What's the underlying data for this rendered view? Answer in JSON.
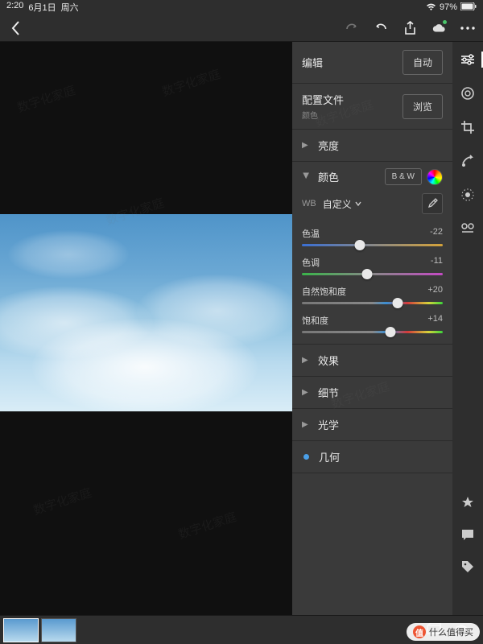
{
  "status": {
    "time": "2:20",
    "date": "6月1日",
    "weekday": "周六",
    "battery": "97%"
  },
  "topbar": {
    "icons": [
      "redo",
      "undo",
      "share",
      "cloud",
      "more"
    ]
  },
  "panel": {
    "edit_label": "编辑",
    "auto_label": "自动",
    "profile_label": "配置文件",
    "profile_value": "颜色",
    "browse_label": "浏览",
    "sections": {
      "light": "亮度",
      "color": "颜色",
      "effects": "效果",
      "detail": "细节",
      "optics": "光学",
      "geometry": "几何"
    },
    "bw_label": "B & W",
    "wb_label": "WB",
    "wb_value": "自定义",
    "sliders": [
      {
        "name": "色温",
        "value": "-22",
        "pos": 41,
        "track": "track-temp"
      },
      {
        "name": "色调",
        "value": "-11",
        "pos": 46,
        "track": "track-tint"
      },
      {
        "name": "自然饱和度",
        "value": "+20",
        "pos": 68,
        "track": "track-vib"
      },
      {
        "name": "饱和度",
        "value": "+14",
        "pos": 63,
        "track": "track-sat"
      }
    ]
  },
  "sidebar": {
    "tools": [
      "adjust",
      "lens",
      "crop",
      "heal",
      "mask",
      "presets"
    ],
    "bottom": [
      "star",
      "comment",
      "tag"
    ]
  },
  "overlay": {
    "text": "什么值得买"
  },
  "watermarks": [
    "数字化家庭"
  ]
}
